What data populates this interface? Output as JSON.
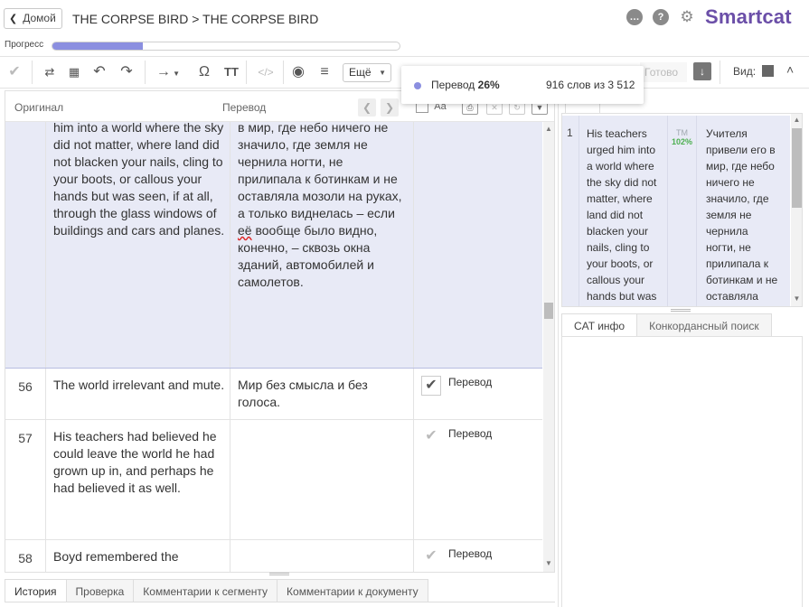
{
  "header": {
    "home_label": "Домой",
    "breadcrumb": "THE CORPSE BIRD > THE CORPSE BIRD",
    "logo": "Smartcat",
    "icons": [
      "chat-icon",
      "help-icon",
      "gear-icon"
    ]
  },
  "progress": {
    "label": "Прогресс",
    "percent": 26
  },
  "toolbar": {
    "more_label": "Ещё",
    "done_label": "Готово",
    "view_label": "Вид:"
  },
  "tooltip": {
    "stage_label": "Перевод",
    "stage_percent": "26%",
    "words": "916 слов из 3 512"
  },
  "editor": {
    "col_source": "Оригинал",
    "col_target": "Перевод",
    "filter_aa": "Aa",
    "segments": [
      {
        "num": "",
        "source": "him into a world where the sky did not matter, where land did not blacken your nails, cling to your boots, or callous your hands but was seen, if at all, through the glass windows of buildings and cars and planes.",
        "target_before": "в мир, где небо ничего не значило, где земля не чернила ногти, не прилипала к ботинкам и не оставляла мозоли на руках, а только виднелась – если ",
        "target_flag": "её",
        "target_after": " вообще было видно, конечно, – сквозь окна зданий, автомобилей и самолетов.",
        "status": ""
      },
      {
        "num": "56",
        "source": "The world irrelevant and mute.",
        "target": "Мир без смысла и без голоса.",
        "status": "Перевод"
      },
      {
        "num": "57",
        "source": "His teachers had believed he could leave the world he had grown up in, and perhaps he had believed it as well.",
        "target": "",
        "status": "Перевод"
      },
      {
        "num": "58",
        "source": "Boyd remembered the",
        "target": "",
        "status": "Перевод"
      }
    ]
  },
  "bottom_tabs": [
    "История",
    "Проверка",
    "Комментарии к сегменту",
    "Комментарии к документу"
  ],
  "cat": {
    "tab_label": "CAT",
    "row_num": "1",
    "source": "His teachers urged him into a world where the sky did not matter, where land did not blacken your nails, cling to your boots, or callous your hands but was",
    "tm_label": "TM",
    "tm_match": "102%",
    "target": "Учителя привели его в мир, где небо ничего не значило, где земля не чернила ногти, не прилипала к ботинкам и не оставляла"
  },
  "right_tabs": [
    "CAT инфо",
    "Конкордансный поиск"
  ],
  "colors": {
    "accent": "#6b4fa8",
    "progress": "#8b8fe0",
    "active_row": "#e8eaf6",
    "tm_match": "#4caf50"
  }
}
